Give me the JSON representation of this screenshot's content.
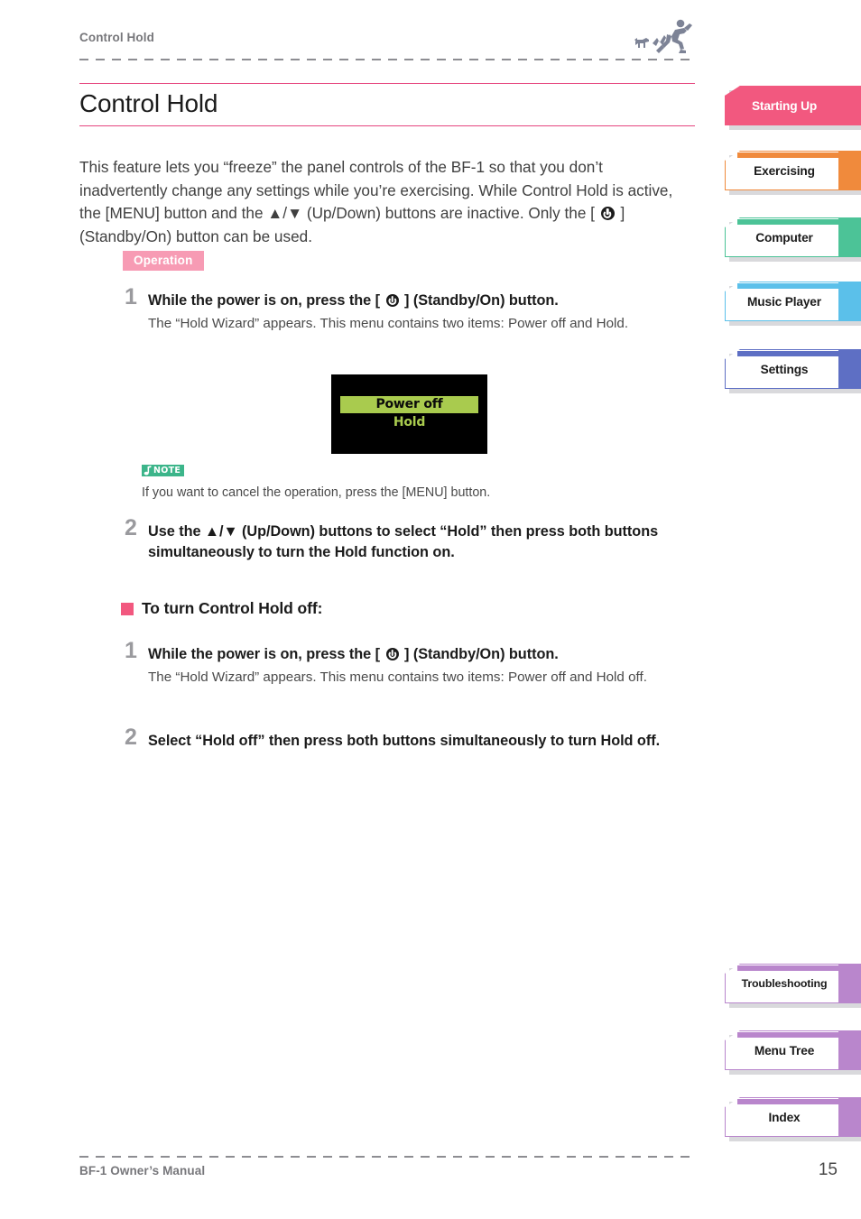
{
  "header": {
    "title": "Control Hold",
    "icon": "runner-and-dog-icon"
  },
  "page": {
    "title": "Control Hold",
    "intro_parts": {
      "a": "This feature lets you “freeze” the panel controls of the BF-1 so that you don’t inadvertently change any settings while you’re exercising. While Control Hold is active, the [MENU] button and the ▲/▼ (Up/Down) buttons are inactive. Only the [ ",
      "b": " ] (Standby/On) button can be used."
    }
  },
  "operation": {
    "badge": "Operation",
    "steps": [
      {
        "number": "1",
        "head_a": "While the power is on, press the [ ",
        "head_b": " ] (Standby/On) button.",
        "body": "The “Hold Wizard” appears. This menu contains two items: Power off and Hold."
      },
      {
        "number": "2",
        "head": "Use the ▲/▼ (Up/Down) buttons to select “Hold” then press both buttons simultaneously to turn the Hold function on."
      }
    ]
  },
  "lcd": {
    "selected_item": "Power off",
    "second_item": "Hold",
    "background_color": "#000000",
    "highlight_color": "#a9cb4e"
  },
  "note": {
    "icon": "music-note-icon",
    "label": "NOTE",
    "text": "If you want to cancel the operation, press the [MENU] button.",
    "badge_color": "#3cb58a"
  },
  "subsection": {
    "marker_color": "#f2587f",
    "title": "To turn Control Hold off:",
    "steps": [
      {
        "number": "1",
        "head_a": "While the power is on, press the [ ",
        "head_b": " ] (Standby/On) button.",
        "body": "The “Hold Wizard” appears. This menu contains two items: Power off and Hold off."
      },
      {
        "number": "2",
        "head": "Select “Hold off” then press both buttons simultaneously to turn Hold off."
      }
    ]
  },
  "sidebar": {
    "top_tabs": [
      {
        "label": "Starting Up",
        "color": "#f2587f",
        "active": true
      },
      {
        "label": "Exercising",
        "color": "#f08a3c",
        "active": false
      },
      {
        "label": "Computer",
        "color": "#4cc397",
        "active": false
      },
      {
        "label": "Music Player",
        "color": "#5bc0ea",
        "active": false
      },
      {
        "label": "Settings",
        "color": "#5e6fc4",
        "active": false
      }
    ],
    "bottom_tabs": [
      {
        "label": "Troubleshooting",
        "color": "#b986cc",
        "active": false
      },
      {
        "label": "Menu Tree",
        "color": "#b986cc",
        "active": false
      },
      {
        "label": "Index",
        "color": "#b986cc",
        "active": false
      }
    ]
  },
  "footer": {
    "left": "BF-1 Owner’s Manual",
    "page_number": "15"
  }
}
